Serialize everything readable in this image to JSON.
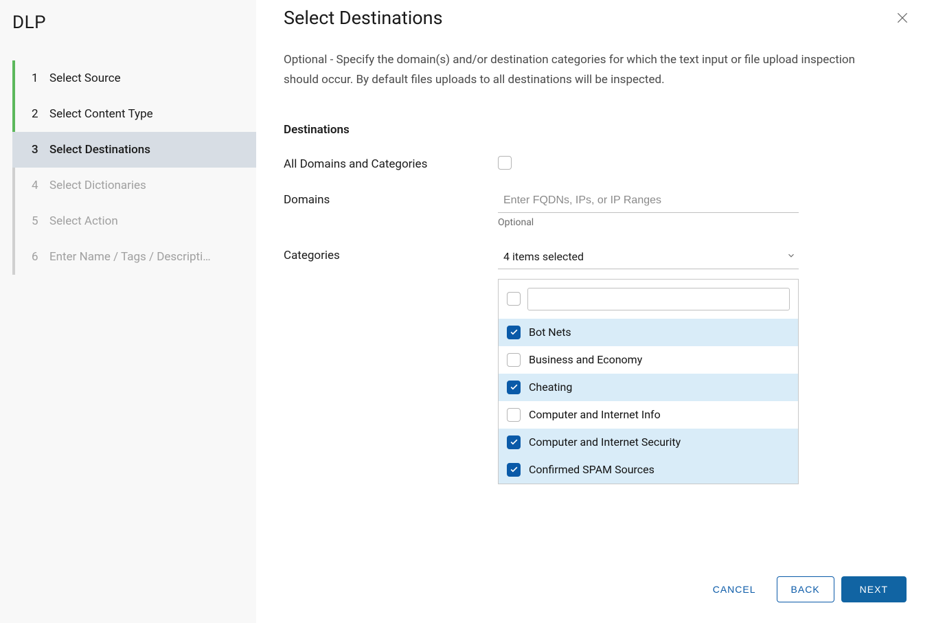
{
  "sidebar": {
    "title": "DLP",
    "steps": [
      {
        "num": "1",
        "label": "Select Source",
        "state": "completed"
      },
      {
        "num": "2",
        "label": "Select Content Type",
        "state": "completed"
      },
      {
        "num": "3",
        "label": "Select Destinations",
        "state": "current"
      },
      {
        "num": "4",
        "label": "Select Dictionaries",
        "state": "pending"
      },
      {
        "num": "5",
        "label": "Select Action",
        "state": "pending"
      },
      {
        "num": "6",
        "label": "Enter Name / Tags / Descripti…",
        "state": "pending"
      }
    ]
  },
  "page": {
    "title": "Select Destinations",
    "description": "Optional - Specify the domain(s) and/or destination categories for which the text input or file upload inspection should occur. By default files uploads to all destinations will be inspected."
  },
  "form": {
    "heading": "Destinations",
    "all_label": "All Domains and Categories",
    "all_checked": false,
    "domains_label": "Domains",
    "domains_placeholder": "Enter FQDNs, IPs, or IP Ranges",
    "domains_helper": "Optional",
    "categories_label": "Categories",
    "categories_summary": "4 items selected",
    "categories_items": [
      {
        "label": "Bot Nets",
        "selected": true
      },
      {
        "label": "Business and Economy",
        "selected": false
      },
      {
        "label": "Cheating",
        "selected": true
      },
      {
        "label": "Computer and Internet Info",
        "selected": false
      },
      {
        "label": "Computer and Internet Security",
        "selected": true
      },
      {
        "label": "Confirmed SPAM Sources",
        "selected": true
      }
    ]
  },
  "footer": {
    "cancel": "CANCEL",
    "back": "BACK",
    "next": "NEXT"
  }
}
